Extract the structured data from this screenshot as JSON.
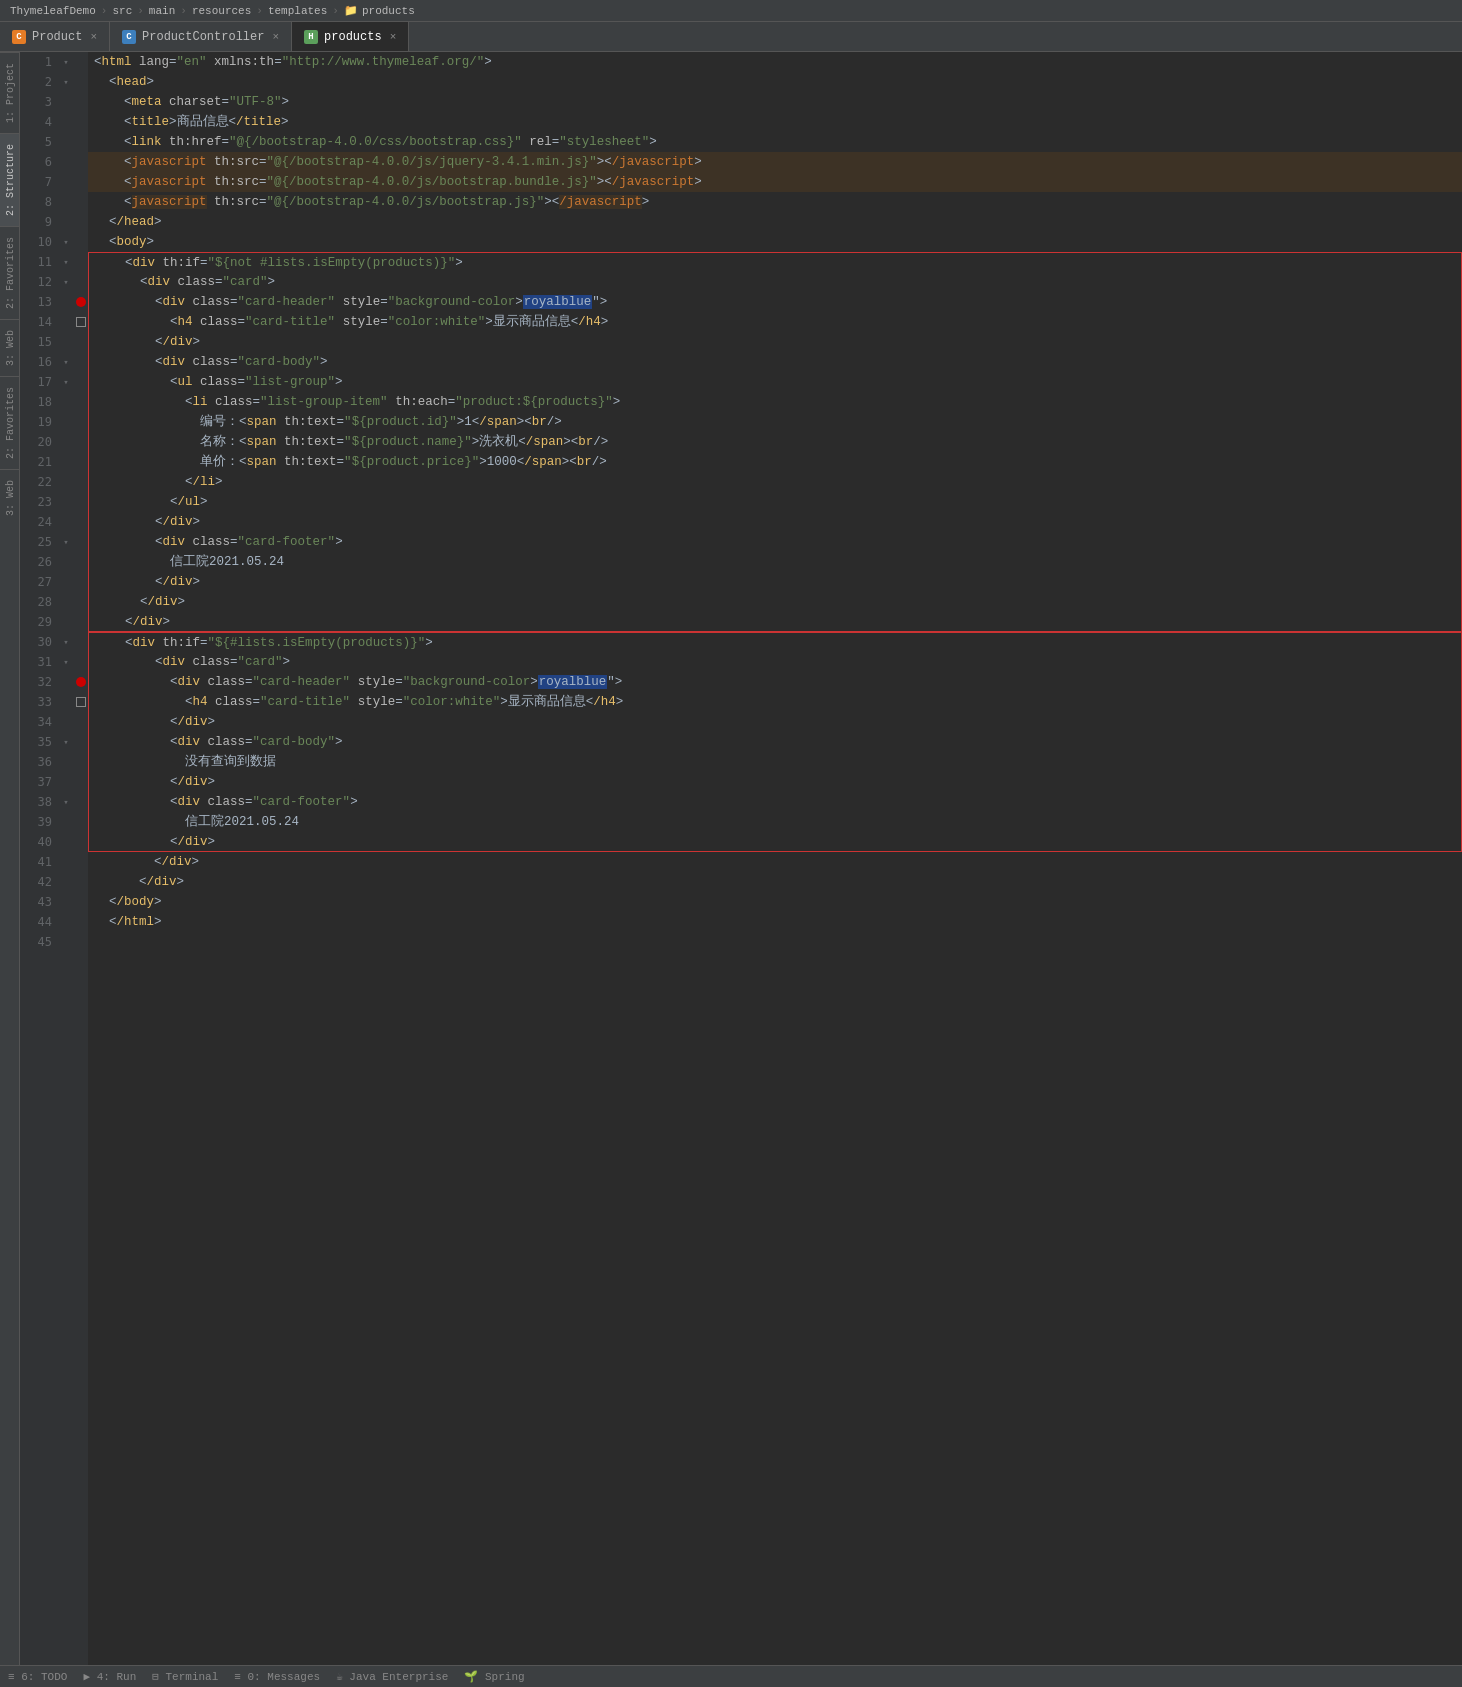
{
  "titleBar": {
    "project": "ThymeleafDemo",
    "path": [
      "src",
      "main",
      "resources",
      "templates",
      "products"
    ]
  },
  "tabs": [
    {
      "id": "product",
      "icon": "C",
      "iconType": "orange",
      "label": "Product",
      "active": false
    },
    {
      "id": "productcontroller",
      "icon": "C",
      "iconType": "blue",
      "label": "ProductController",
      "active": false
    },
    {
      "id": "products",
      "icon": "H",
      "iconType": "html",
      "label": "products",
      "active": true
    }
  ],
  "sidebar": {
    "items": [
      {
        "id": "project",
        "label": "1: Project",
        "active": false
      },
      {
        "id": "structure",
        "label": "2: Structure",
        "active": false
      },
      {
        "id": "favorites",
        "label": "2: Favorites",
        "active": false
      },
      {
        "id": "web",
        "label": "3: Web",
        "active": false
      },
      {
        "id": "favorites2",
        "label": "2: Favorites",
        "active": false
      },
      {
        "id": "web2",
        "label": "3: Web",
        "active": false
      }
    ]
  },
  "code": {
    "lines": [
      {
        "num": 1,
        "fold": "▾",
        "bp": "",
        "content": "<html lang=\"en\" xmlns:th=\"http://www.thymeleaf.org/\">",
        "highlight": ""
      },
      {
        "num": 2,
        "fold": "▾",
        "bp": "",
        "content": "  <head>",
        "highlight": ""
      },
      {
        "num": 3,
        "fold": "",
        "bp": "",
        "content": "    <meta charset=\"UTF-8\">",
        "highlight": ""
      },
      {
        "num": 4,
        "fold": "",
        "bp": "",
        "content": "    <title>商品信息</title>",
        "highlight": ""
      },
      {
        "num": 5,
        "fold": "",
        "bp": "",
        "content": "    <link th:href=\"@{/bootstrap-4.0.0/css/bootstrap.css}\" rel=\"stylesheet\">",
        "highlight": ""
      },
      {
        "num": 6,
        "fold": "",
        "bp": "",
        "content": "    <javascript th:src=\"@{/bootstrap-4.0.0/js/jquery-3.4.1.min.js}\"></javascript>",
        "highlight": "yellow"
      },
      {
        "num": 7,
        "fold": "",
        "bp": "",
        "content": "    <javascript th:src=\"@{/bootstrap-4.0.0/js/bootstrap.bundle.js}\"></javascript>",
        "highlight": "yellow"
      },
      {
        "num": 8,
        "fold": "",
        "bp": "",
        "content": "    <javascript th:src=\"@{/bootstrap-4.0.0/js/bootstrap.js}\"></javascript>",
        "highlight": ""
      },
      {
        "num": 9,
        "fold": "",
        "bp": "",
        "content": "  </head>",
        "highlight": ""
      },
      {
        "num": 10,
        "fold": "▾",
        "bp": "",
        "content": "  <body>",
        "highlight": ""
      },
      {
        "num": 11,
        "fold": "▾",
        "bp": "",
        "content": "    <div th:if=\"${not #lists.isEmpty(products)}\">",
        "highlight": "block1-start"
      },
      {
        "num": 12,
        "fold": "▾",
        "bp": "",
        "content": "      <div class=\"card\">",
        "highlight": ""
      },
      {
        "num": 13,
        "fold": "",
        "bp": "dot",
        "content": "        <div class=\"card-header\" style=\"background-color:royalblue\">",
        "highlight": "royalblue"
      },
      {
        "num": 14,
        "fold": "",
        "bp": "empty",
        "content": "          <h4 class=\"card-title\" style=\"color:white\">显示商品信息</h4>",
        "highlight": ""
      },
      {
        "num": 15,
        "fold": "",
        "bp": "",
        "content": "        </div>",
        "highlight": ""
      },
      {
        "num": 16,
        "fold": "▾",
        "bp": "",
        "content": "        <div class=\"card-body\">",
        "highlight": ""
      },
      {
        "num": 17,
        "fold": "▾",
        "bp": "",
        "content": "          <ul class=\"list-group\">",
        "highlight": ""
      },
      {
        "num": 18,
        "fold": "",
        "bp": "",
        "content": "            <li class=\"list-group-item\" th:each=\"product:${products}\">",
        "highlight": ""
      },
      {
        "num": 19,
        "fold": "",
        "bp": "",
        "content": "              编号：<span th:text=\"${product.id}\">1</span><br/>",
        "highlight": ""
      },
      {
        "num": 20,
        "fold": "",
        "bp": "",
        "content": "              名称：<span th:text=\"${product.name}\">洗衣机</span><br/>",
        "highlight": ""
      },
      {
        "num": 21,
        "fold": "",
        "bp": "",
        "content": "              单价：<span th:text=\"${product.price}\">1000</span><br/>",
        "highlight": ""
      },
      {
        "num": 22,
        "fold": "",
        "bp": "",
        "content": "            </li>",
        "highlight": ""
      },
      {
        "num": 23,
        "fold": "",
        "bp": "",
        "content": "          </ul>",
        "highlight": ""
      },
      {
        "num": 24,
        "fold": "",
        "bp": "",
        "content": "        </div>",
        "highlight": ""
      },
      {
        "num": 25,
        "fold": "▾",
        "bp": "",
        "content": "        <div class=\"card-footer\">",
        "highlight": ""
      },
      {
        "num": 26,
        "fold": "",
        "bp": "",
        "content": "          信工院2021.05.24",
        "highlight": ""
      },
      {
        "num": 27,
        "fold": "",
        "bp": "",
        "content": "        </div>",
        "highlight": ""
      },
      {
        "num": 28,
        "fold": "",
        "bp": "",
        "content": "      </div>",
        "highlight": ""
      },
      {
        "num": 29,
        "fold": "",
        "bp": "",
        "content": "    </div>",
        "highlight": "block1-end"
      },
      {
        "num": 30,
        "fold": "▾",
        "bp": "",
        "content": "    <div th:if=\"${#lists.isEmpty(products)}\">",
        "highlight": "block2-start"
      },
      {
        "num": 31,
        "fold": "▾",
        "bp": "",
        "content": "        <div class=\"card\">",
        "highlight": ""
      },
      {
        "num": 32,
        "fold": "",
        "bp": "dot",
        "content": "          <div class=\"card-header\" style=\"background-color:royalblue\">",
        "highlight": "royalblue"
      },
      {
        "num": 33,
        "fold": "",
        "bp": "empty",
        "content": "            <h4 class=\"card-title\" style=\"color:white\">显示商品信息</h4>",
        "highlight": ""
      },
      {
        "num": 34,
        "fold": "",
        "bp": "",
        "content": "          </div>",
        "highlight": ""
      },
      {
        "num": 35,
        "fold": "▾",
        "bp": "",
        "content": "          <div class=\"card-body\">",
        "highlight": ""
      },
      {
        "num": 36,
        "fold": "",
        "bp": "",
        "content": "            没有查询到数据",
        "highlight": ""
      },
      {
        "num": 37,
        "fold": "",
        "bp": "",
        "content": "          </div>",
        "highlight": ""
      },
      {
        "num": 38,
        "fold": "▾",
        "bp": "",
        "content": "          <div class=\"card-footer\">",
        "highlight": ""
      },
      {
        "num": 39,
        "fold": "",
        "bp": "",
        "content": "            信工院2021.05.24",
        "highlight": ""
      },
      {
        "num": 40,
        "fold": "",
        "bp": "",
        "content": "          </div>",
        "highlight": "block2-end"
      },
      {
        "num": 41,
        "fold": "",
        "bp": "",
        "content": "        </div>",
        "highlight": ""
      },
      {
        "num": 42,
        "fold": "",
        "bp": "",
        "content": "      </div>",
        "highlight": ""
      },
      {
        "num": 43,
        "fold": "",
        "bp": "",
        "content": "  </body>",
        "highlight": ""
      },
      {
        "num": 44,
        "fold": "",
        "bp": "",
        "content": "  </html>",
        "highlight": ""
      },
      {
        "num": 45,
        "fold": "",
        "bp": "",
        "content": "",
        "highlight": ""
      }
    ]
  },
  "bottomBar": {
    "items": [
      {
        "icon": "≡",
        "label": "6: TODO"
      },
      {
        "icon": "▶",
        "label": "4: Run"
      },
      {
        "icon": "⊟",
        "label": "Terminal"
      },
      {
        "icon": "≡",
        "label": "0: Messages"
      },
      {
        "icon": "☕",
        "label": "Java Enterprise"
      },
      {
        "icon": "🌱",
        "label": "Spring"
      }
    ]
  }
}
